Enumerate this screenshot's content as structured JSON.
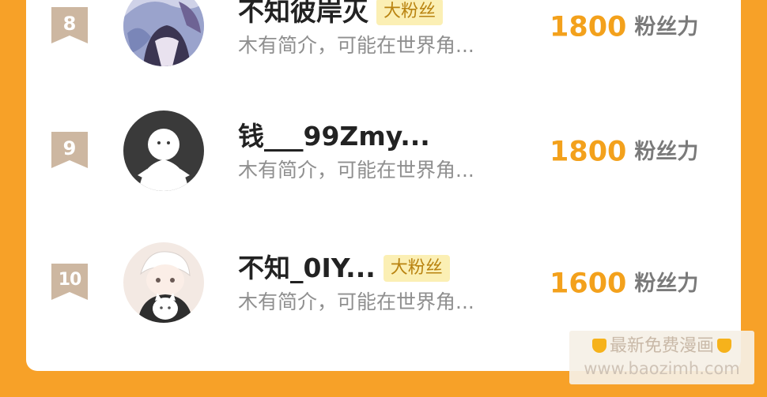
{
  "colors": {
    "page_background": "#f7a128",
    "card_background": "#ffffff",
    "power_value": "#f3a11c",
    "fan_tag_background": "#fbefb4",
    "fan_tag_text": "#b98310",
    "rank_badge": "#cdb7a1"
  },
  "ranking": [
    {
      "rank": "8",
      "name": "不知彼岸灭",
      "tag": "大粉丝",
      "intro": "木有简介，可能在世界角...",
      "power_value": "1800",
      "power_label": "粉丝力",
      "avatar_icon": "anime-girl-avatar-icon"
    },
    {
      "rank": "9",
      "name": "钱___99Zmy...",
      "tag": "",
      "intro": "木有简介，可能在世界角...",
      "power_value": "1800",
      "power_label": "粉丝力",
      "avatar_icon": "default-ghost-avatar-icon"
    },
    {
      "rank": "10",
      "name": "不知_0IY...",
      "tag": "大粉丝",
      "intro": "木有简介，可能在世界角...",
      "power_value": "1600",
      "power_label": "粉丝力",
      "avatar_icon": "anime-boy-with-cat-avatar-icon"
    }
  ],
  "watermark": {
    "line1": "最新免费漫画",
    "line2": "www.baozimh.com",
    "icon": "pointing-down-hand-icon"
  }
}
